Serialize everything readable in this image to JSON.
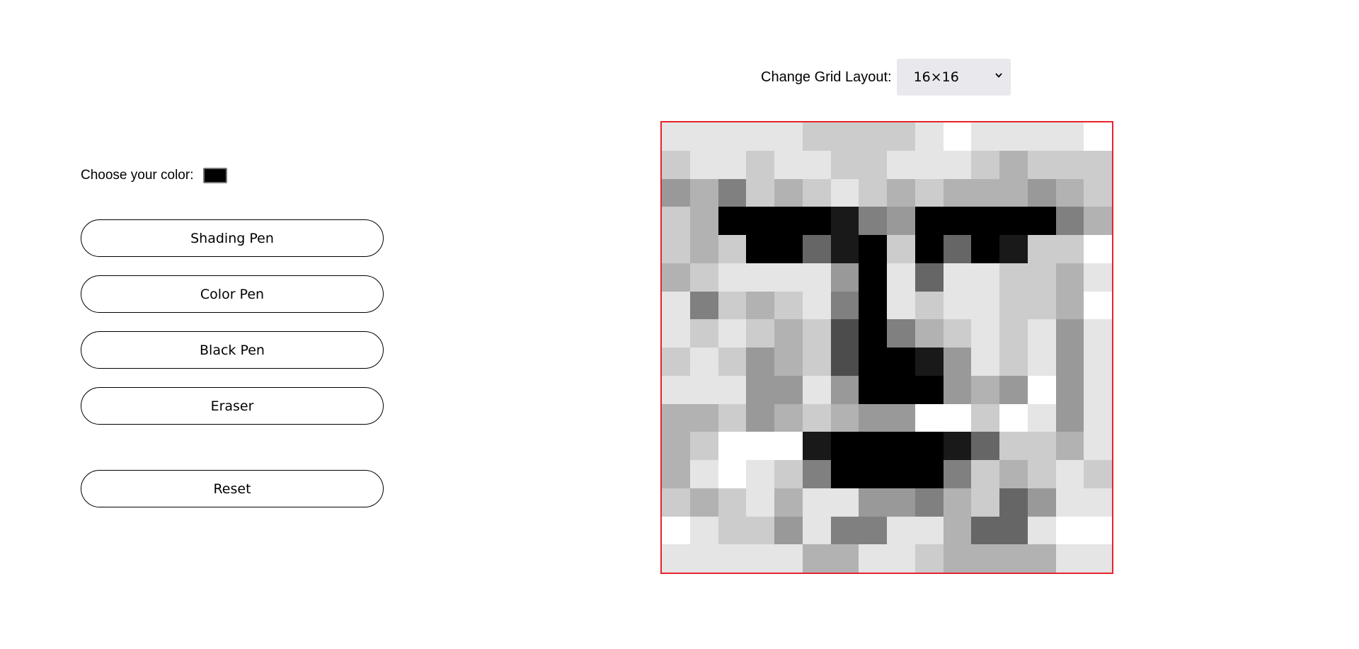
{
  "controls": {
    "color_label": "Choose your color:",
    "color_value": "#000000",
    "shading_pen": "Shading Pen",
    "color_pen": "Color Pen",
    "black_pen": "Black Pen",
    "eraser": "Eraser",
    "reset": "Reset"
  },
  "layout": {
    "label": "Change Grid Layout:",
    "selected": "16×16"
  },
  "grid": {
    "rows": 16,
    "cols": 16,
    "cells": [
      [
        "#e5e5e5",
        "#e5e5e5",
        "#e5e5e5",
        "#e5e5e5",
        "#e5e5e5",
        "#cccccc",
        "#cccccc",
        "#cccccc",
        "#cccccc",
        "#e5e5e5",
        "#ffffff",
        "#e5e5e5",
        "#e5e5e5",
        "#e5e5e5",
        "#e5e5e5",
        "#ffffff"
      ],
      [
        "#cccccc",
        "#e5e5e5",
        "#e5e5e5",
        "#cccccc",
        "#e5e5e5",
        "#e5e5e5",
        "#cccccc",
        "#cccccc",
        "#e5e5e5",
        "#e5e5e5",
        "#e5e5e5",
        "#cccccc",
        "#b2b2b2",
        "#cccccc",
        "#cccccc",
        "#cccccc"
      ],
      [
        "#999999",
        "#b2b2b2",
        "#808080",
        "#cccccc",
        "#b2b2b2",
        "#cccccc",
        "#e5e5e5",
        "#cccccc",
        "#b2b2b2",
        "#cccccc",
        "#b2b2b2",
        "#b2b2b2",
        "#b2b2b2",
        "#999999",
        "#b2b2b2",
        "#cccccc"
      ],
      [
        "#cccccc",
        "#b2b2b2",
        "#000000",
        "#000000",
        "#000000",
        "#000000",
        "#191919",
        "#808080",
        "#999999",
        "#000000",
        "#000000",
        "#000000",
        "#000000",
        "#000000",
        "#808080",
        "#b2b2b2"
      ],
      [
        "#cccccc",
        "#b2b2b2",
        "#cccccc",
        "#000000",
        "#000000",
        "#666666",
        "#191919",
        "#000000",
        "#cccccc",
        "#000000",
        "#666666",
        "#000000",
        "#191919",
        "#cccccc",
        "#cccccc",
        "#ffffff"
      ],
      [
        "#b2b2b2",
        "#cccccc",
        "#e5e5e5",
        "#e5e5e5",
        "#e5e5e5",
        "#e5e5e5",
        "#999999",
        "#000000",
        "#e5e5e5",
        "#666666",
        "#e5e5e5",
        "#e5e5e5",
        "#cccccc",
        "#cccccc",
        "#b2b2b2",
        "#e5e5e5"
      ],
      [
        "#e5e5e5",
        "#808080",
        "#cccccc",
        "#b2b2b2",
        "#cccccc",
        "#e5e5e5",
        "#808080",
        "#000000",
        "#e5e5e5",
        "#cccccc",
        "#e5e5e5",
        "#e5e5e5",
        "#cccccc",
        "#cccccc",
        "#b2b2b2",
        "#ffffff"
      ],
      [
        "#e5e5e5",
        "#cccccc",
        "#e5e5e5",
        "#cccccc",
        "#b2b2b2",
        "#cccccc",
        "#4c4c4c",
        "#000000",
        "#808080",
        "#b2b2b2",
        "#cccccc",
        "#e5e5e5",
        "#cccccc",
        "#e5e5e5",
        "#999999",
        "#e5e5e5"
      ],
      [
        "#cccccc",
        "#e5e5e5",
        "#cccccc",
        "#999999",
        "#b2b2b2",
        "#cccccc",
        "#4c4c4c",
        "#000000",
        "#000000",
        "#191919",
        "#999999",
        "#e5e5e5",
        "#cccccc",
        "#e5e5e5",
        "#999999",
        "#e5e5e5"
      ],
      [
        "#e5e5e5",
        "#e5e5e5",
        "#e5e5e5",
        "#999999",
        "#999999",
        "#e5e5e5",
        "#999999",
        "#000000",
        "#000000",
        "#000000",
        "#999999",
        "#b2b2b2",
        "#999999",
        "#ffffff",
        "#999999",
        "#e5e5e5"
      ],
      [
        "#b2b2b2",
        "#b2b2b2",
        "#cccccc",
        "#999999",
        "#b2b2b2",
        "#cccccc",
        "#b2b2b2",
        "#999999",
        "#999999",
        "#ffffff",
        "#ffffff",
        "#cccccc",
        "#ffffff",
        "#e5e5e5",
        "#999999",
        "#e5e5e5"
      ],
      [
        "#b2b2b2",
        "#cccccc",
        "#ffffff",
        "#ffffff",
        "#ffffff",
        "#191919",
        "#000000",
        "#000000",
        "#000000",
        "#000000",
        "#191919",
        "#666666",
        "#cccccc",
        "#cccccc",
        "#b2b2b2",
        "#e5e5e5"
      ],
      [
        "#b2b2b2",
        "#e5e5e5",
        "#ffffff",
        "#e5e5e5",
        "#cccccc",
        "#808080",
        "#000000",
        "#000000",
        "#000000",
        "#000000",
        "#808080",
        "#cccccc",
        "#b2b2b2",
        "#cccccc",
        "#e5e5e5",
        "#cccccc"
      ],
      [
        "#cccccc",
        "#b2b2b2",
        "#cccccc",
        "#e5e5e5",
        "#b2b2b2",
        "#e5e5e5",
        "#e5e5e5",
        "#999999",
        "#999999",
        "#808080",
        "#b2b2b2",
        "#cccccc",
        "#666666",
        "#999999",
        "#e5e5e5",
        "#e5e5e5"
      ],
      [
        "#ffffff",
        "#e5e5e5",
        "#cccccc",
        "#cccccc",
        "#999999",
        "#e5e5e5",
        "#808080",
        "#808080",
        "#e5e5e5",
        "#e5e5e5",
        "#b2b2b2",
        "#666666",
        "#666666",
        "#e5e5e5",
        "#ffffff",
        "#ffffff"
      ],
      [
        "#e5e5e5",
        "#e5e5e5",
        "#e5e5e5",
        "#e5e5e5",
        "#e5e5e5",
        "#b2b2b2",
        "#b2b2b2",
        "#e5e5e5",
        "#e5e5e5",
        "#cccccc",
        "#b2b2b2",
        "#b2b2b2",
        "#b2b2b2",
        "#b2b2b2",
        "#e5e5e5",
        "#e5e5e5"
      ]
    ]
  }
}
